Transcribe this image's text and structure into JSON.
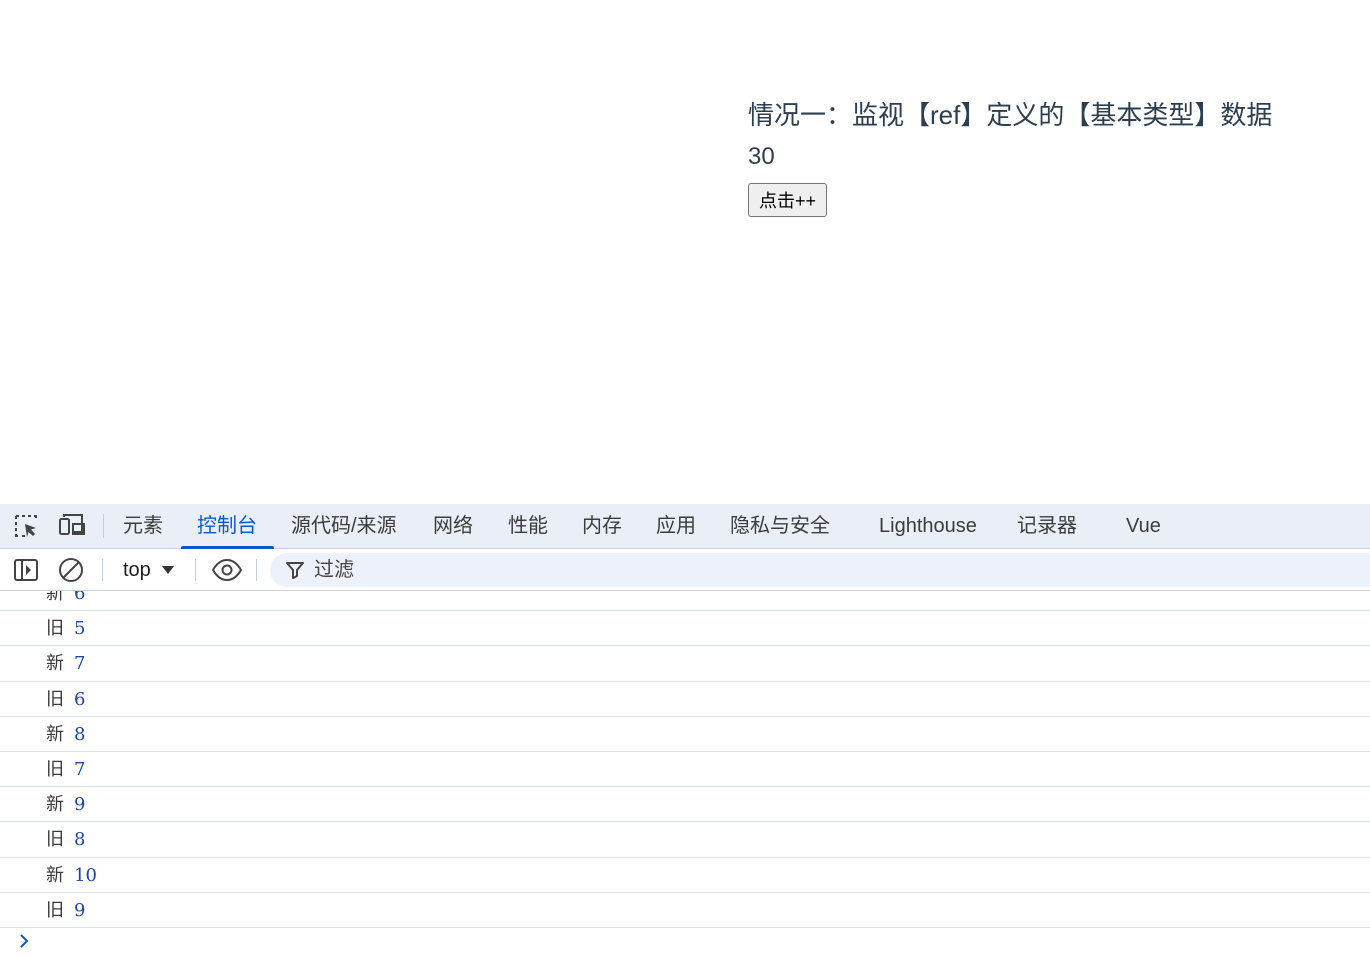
{
  "page": {
    "title": "情况一：监视【ref】定义的【基本类型】数据",
    "count": "30",
    "button_label": "点击++"
  },
  "devtools": {
    "tabs": [
      {
        "label": "元素"
      },
      {
        "label": "控制台"
      },
      {
        "label": "源代码/来源"
      },
      {
        "label": "网络"
      },
      {
        "label": "性能"
      },
      {
        "label": "内存"
      },
      {
        "label": "应用"
      },
      {
        "label": "隐私与安全"
      },
      {
        "label": "Lighthouse"
      },
      {
        "label": "记录器"
      },
      {
        "label": "Vue"
      }
    ],
    "active_tab": "控制台",
    "toolbar": {
      "context": "top",
      "filter_placeholder": "过滤"
    },
    "console_lines": [
      {
        "label": "新",
        "value": "6"
      },
      {
        "label": "旧",
        "value": "5"
      },
      {
        "label": "新",
        "value": "7"
      },
      {
        "label": "旧",
        "value": "6"
      },
      {
        "label": "新",
        "value": "8"
      },
      {
        "label": "旧",
        "value": "7"
      },
      {
        "label": "新",
        "value": "9"
      },
      {
        "label": "旧",
        "value": "8"
      },
      {
        "label": "新",
        "value": "10"
      },
      {
        "label": "旧",
        "value": "9"
      }
    ],
    "colors": {
      "accent": "#0b57d0",
      "tabbar_bg": "#e9eef7",
      "number": "#1a46a8"
    }
  }
}
